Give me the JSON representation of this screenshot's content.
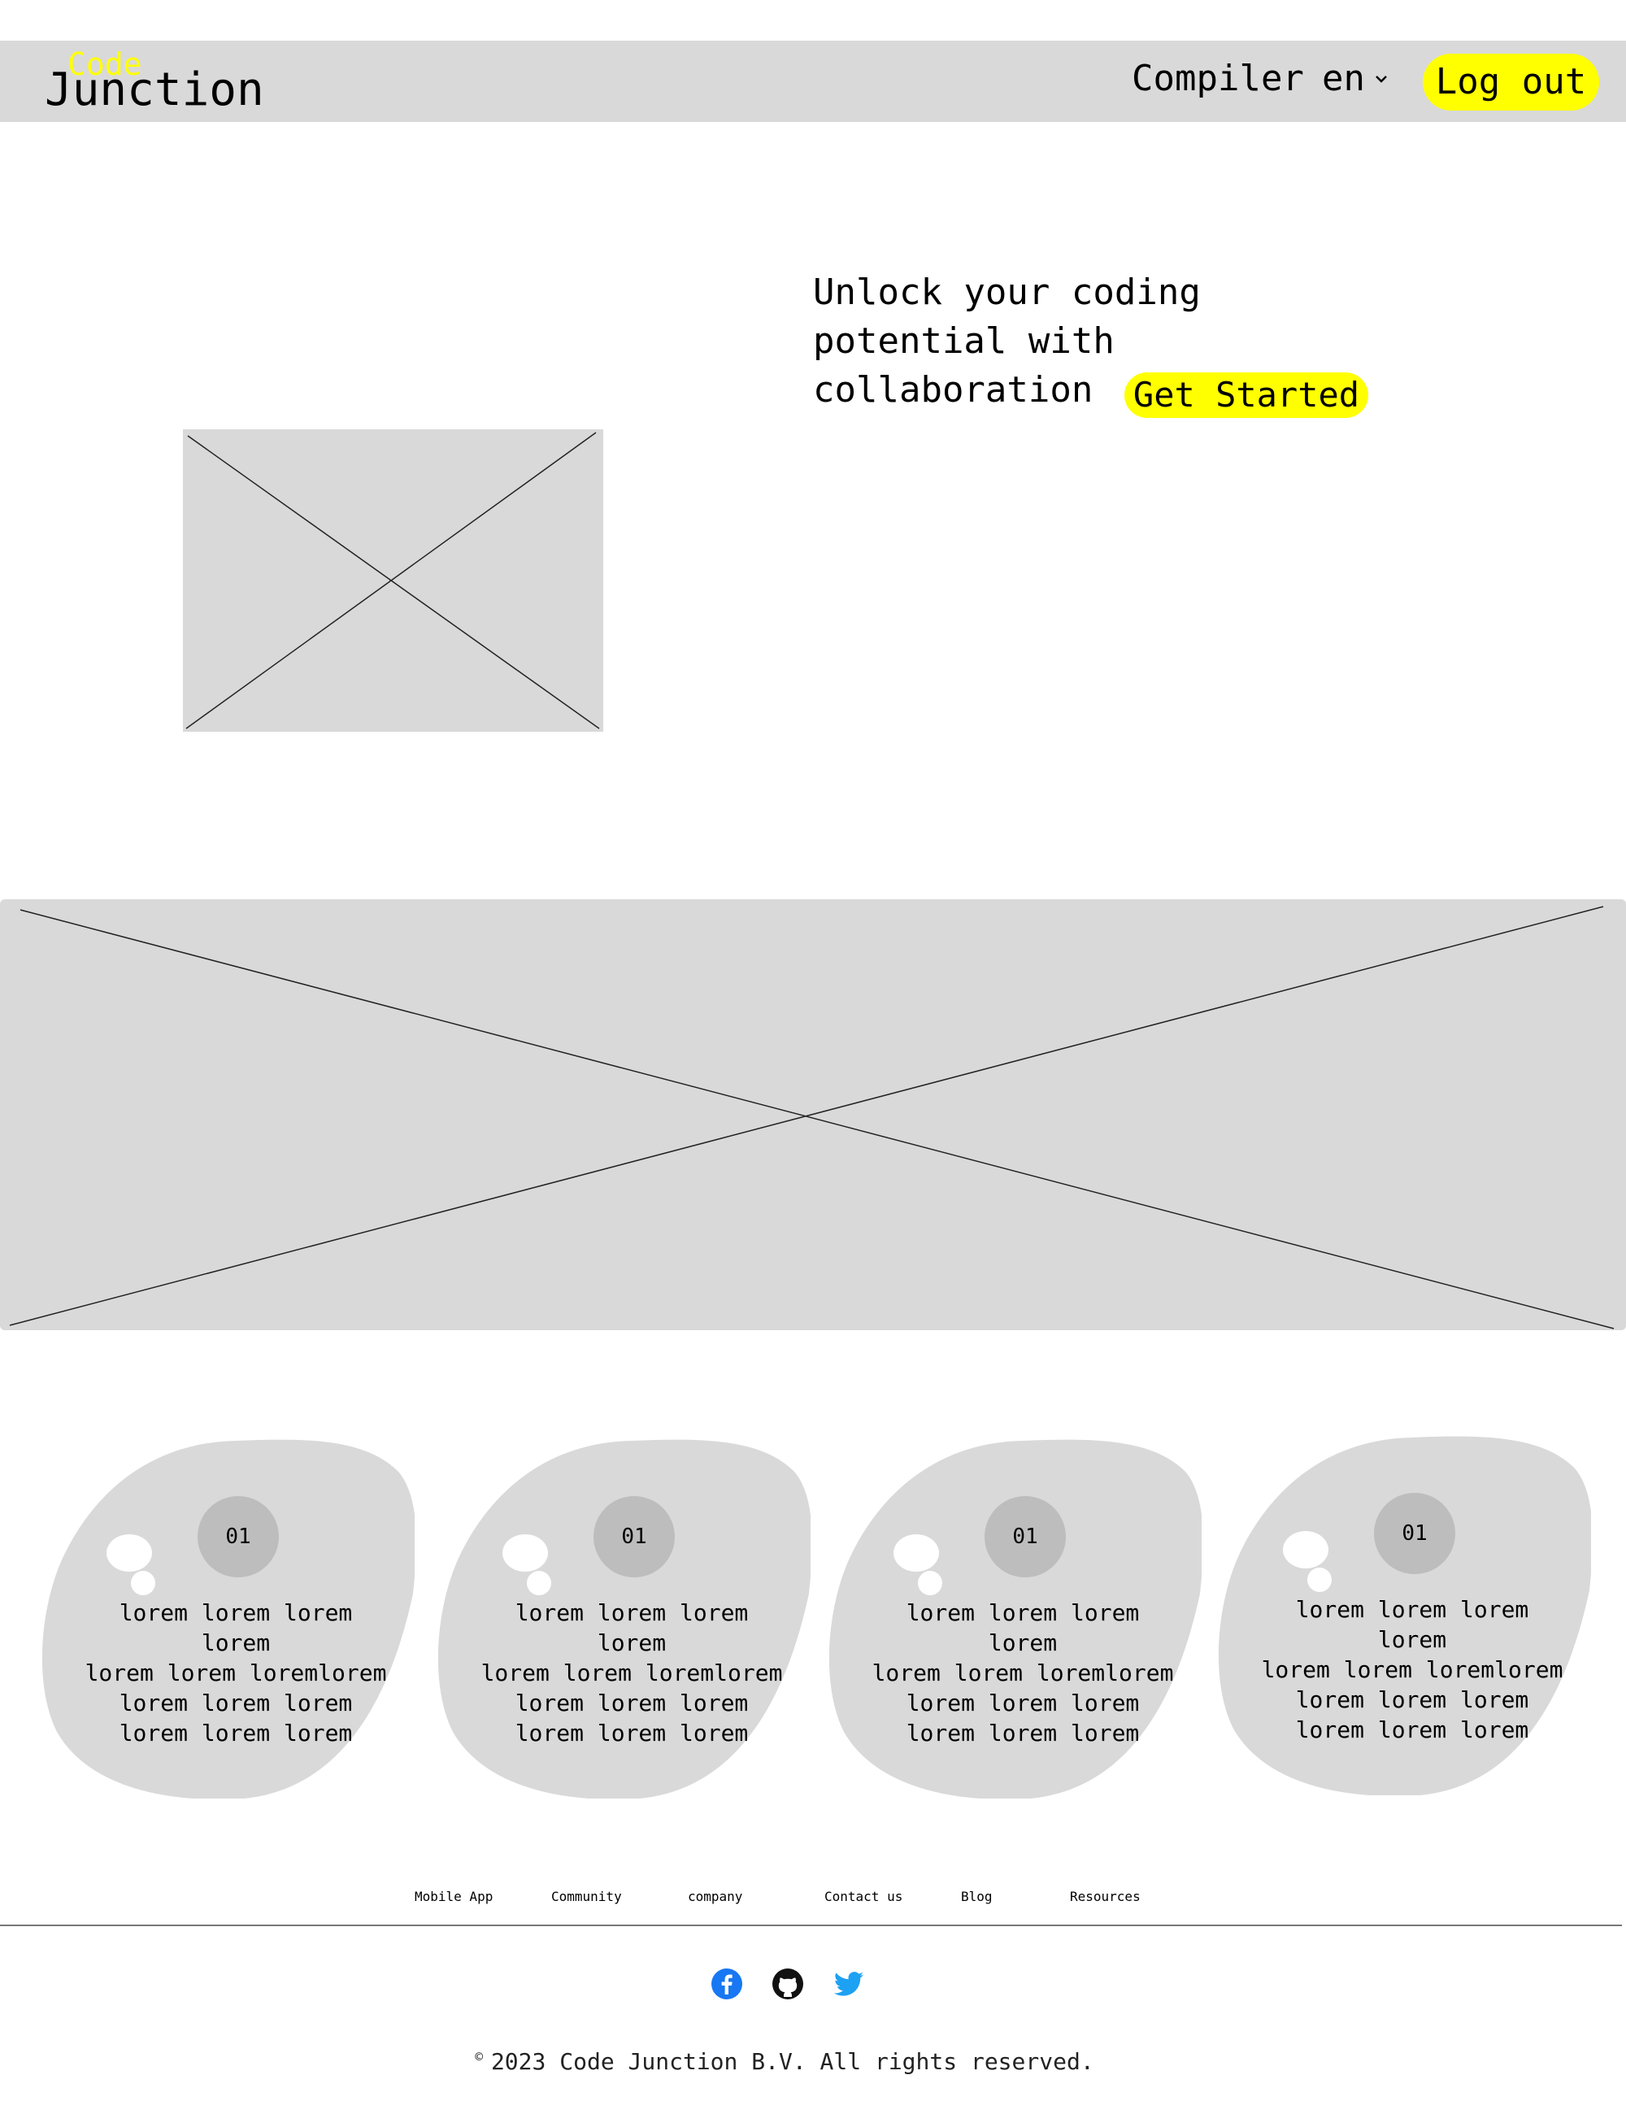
{
  "navbar": {
    "logo_top": "Code",
    "logo_bottom": "Junction",
    "compiler_label": "Compiler",
    "language_value": "en",
    "logout_label": "Log out"
  },
  "hero": {
    "title": "Unlock your coding potential with collaboration",
    "cta_label": "Get Started"
  },
  "features": [
    {
      "number": "01",
      "text": "lorem lorem lorem lorem\nlorem lorem loremlorem\nlorem  lorem  lorem\nlorem  lorem  lorem"
    },
    {
      "number": "01",
      "text": "lorem lorem lorem lorem\nlorem lorem loremlorem\nlorem  lorem  lorem\nlorem  lorem  lorem"
    },
    {
      "number": "01",
      "text": "lorem lorem lorem lorem\nlorem lorem loremlorem\nlorem  lorem  lorem\nlorem  lorem  lorem"
    },
    {
      "number": "01",
      "text": "lorem lorem lorem lorem\nlorem lorem loremlorem\nlorem  lorem  lorem\nlorem  lorem  lorem"
    }
  ],
  "footer": {
    "links": [
      "Mobile App",
      "Community",
      "company",
      "Contact us",
      "Blog",
      "Resources"
    ],
    "socials": [
      "facebook-icon",
      "github-icon",
      "twitter-icon"
    ],
    "copyright_symbol": "©",
    "copyright": "2023 Code Junction B.V. All rights reserved."
  },
  "colors": {
    "accent": "#ffff00",
    "placeholder": "#d9d9d9",
    "number_circle": "#bdbdbd",
    "facebook": "#1877f2",
    "twitter": "#1da1f2"
  }
}
